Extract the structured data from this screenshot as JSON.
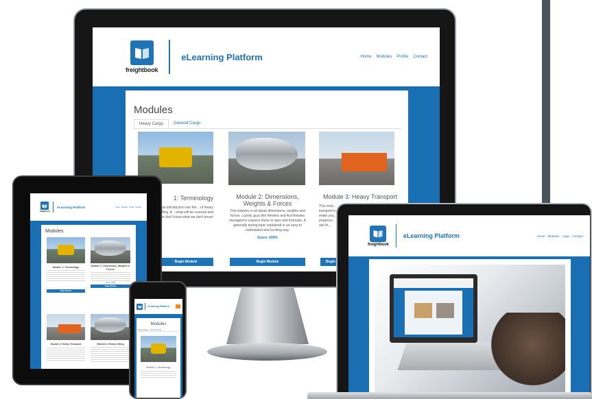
{
  "brand": {
    "logo_word": "freightbook",
    "site_title": "eLearning Platform",
    "accent_color": "#1f73b7"
  },
  "desktop": {
    "nav": [
      "Home",
      "Modules",
      "Profile",
      "Contact"
    ],
    "page_title": "Modules",
    "tabs": [
      "Heavy Cargo",
      "General Cargo"
    ],
    "cards": [
      {
        "title": "1: Terminology",
        "body": "...dule is an introduction into the ...of heavy transport and lifting. A ...what will be covered and how it ...we don't know what we don't know!",
        "button": "Begin Module"
      },
      {
        "title": "Module 2: Dimensions, Weights & Forces",
        "body": "This industry is all about dimensions, weights and forces. Luckily guys like Newton and Archimedes managed to express these in laws and formulas. A generally boring topic explained in an easy to understand and exciting way.",
        "score": "Score: 100%",
        "button": "Begin Module"
      },
      {
        "title": "Module 3: Heavy Transport",
        "body": "This mod... transport b... make you... progress... to ask th...",
        "button": "Begin Module"
      }
    ]
  },
  "tablet": {
    "nav": [
      "Home",
      "Modules",
      "Profile",
      "Contact"
    ],
    "page_title": "Modules",
    "cards": [
      {
        "title": "Module 1: Terminology",
        "button": "Begin Module"
      },
      {
        "title": "Module 2: Dimensions, Weights & Forces",
        "score": "Score: 100%",
        "button": "Begin Module"
      },
      {
        "title": "Module 3: Heavy Transport"
      },
      {
        "title": "Module 4: Heavy Lifting"
      }
    ]
  },
  "phone": {
    "page_title": "Modules",
    "tabs": [
      "Heavy Cargo",
      "General Cargo"
    ],
    "card_title": "Module 1: Terminology"
  },
  "laptop": {
    "nav": [
      "Home",
      "Modules",
      "Login",
      "Contact"
    ]
  }
}
